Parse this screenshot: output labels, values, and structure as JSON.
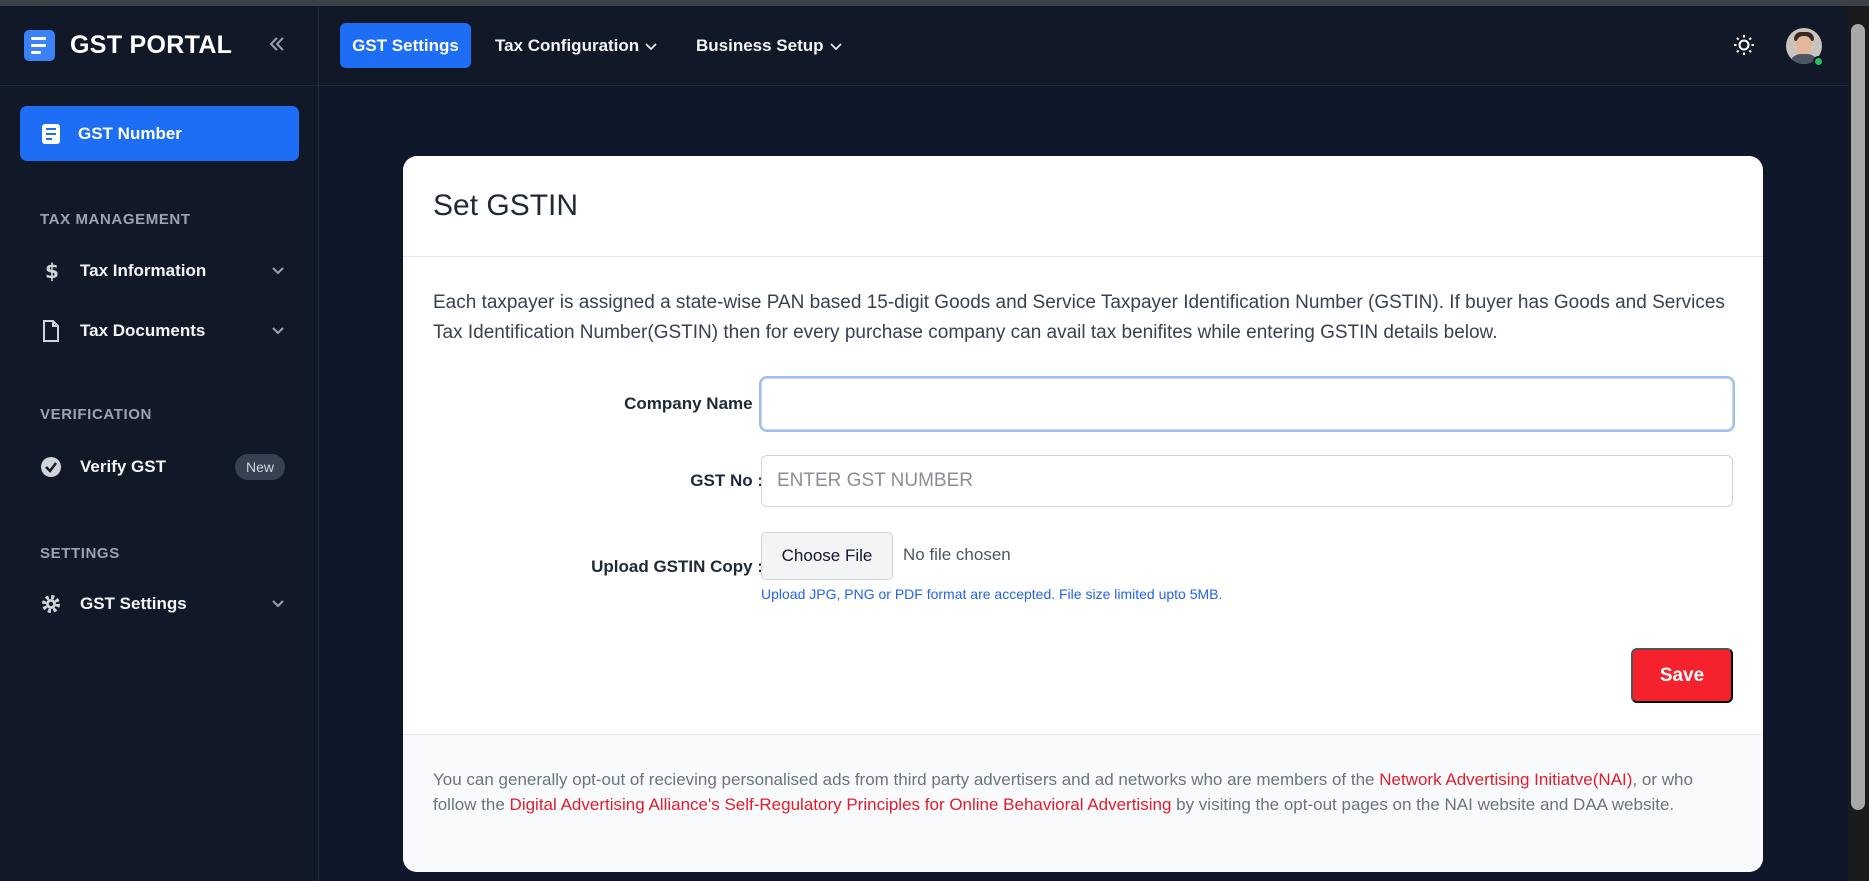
{
  "brand": {
    "title": "GST PORTAL"
  },
  "sidebar": {
    "active_item": {
      "label": "GST Number"
    },
    "sections": [
      {
        "title": "TAX MANAGEMENT",
        "items": [
          {
            "label": "Tax Information"
          },
          {
            "label": "Tax Documents"
          }
        ]
      },
      {
        "title": "VERIFICATION",
        "items": [
          {
            "label": "Verify GST",
            "badge": "New"
          }
        ]
      },
      {
        "title": "SETTINGS",
        "items": [
          {
            "label": "GST Settings"
          }
        ]
      }
    ]
  },
  "topnav": {
    "tabs": [
      {
        "label": "GST Settings",
        "active": true
      },
      {
        "label": "Tax Configuration"
      },
      {
        "label": "Business Setup"
      }
    ]
  },
  "form": {
    "title": "Set GSTIN",
    "description": "Each taxpayer is assigned a state-wise PAN based 15-digit Goods and Service Taxpayer Identification Number (GSTIN). If buyer has Goods and Services Tax Identification Number(GSTIN) then for every purchase company can avail tax benifites while entering GSTIN details below.",
    "company_name": {
      "label": "Company Name :",
      "value": ""
    },
    "gst_no": {
      "label": "GST No :",
      "placeholder": "ENTER GST NUMBER"
    },
    "upload": {
      "label": "Upload GSTIN Copy :",
      "button": "Choose File",
      "status": "No file chosen",
      "hint": "Upload JPG, PNG or PDF format are accepted. File size limited upto 5MB."
    },
    "save_label": "Save"
  },
  "footer": {
    "text1": "You can generally opt-out of recieving personalised ads from third party advertisers and ad networks who are members of the ",
    "link1": "Network Advertising Initiatve(NAI)",
    "text2": ", or who follow the ",
    "link2": "Digital Advertising Alliance's Self-Regulatory Principles for Online Behavioral Advertising",
    "text3": " by visiting the opt-out pages on the NAI website and DAA website."
  },
  "colors": {
    "accent": "#1d6ef5",
    "danger": "#f5222d",
    "sidebar_bg": "#111827",
    "main_bg": "#0f172a"
  }
}
